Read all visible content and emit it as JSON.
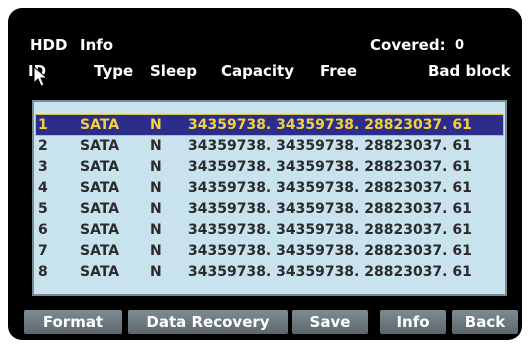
{
  "header": {
    "title_hdd": "HDD",
    "title_info": "Info",
    "covered_label": "Covered:",
    "covered_value": "0"
  },
  "columns": [
    "ID",
    "Type",
    "Sleep",
    "Capacity",
    "Free",
    "Bad block"
  ],
  "rows": [
    {
      "id": "1",
      "type": "SATA",
      "sleep": "N",
      "values": "34359738. 34359738. 28823037. 61"
    },
    {
      "id": "2",
      "type": "SATA",
      "sleep": "N",
      "values": "34359738. 34359738. 28823037. 61"
    },
    {
      "id": "3",
      "type": "SATA",
      "sleep": "N",
      "values": "34359738. 34359738. 28823037. 61"
    },
    {
      "id": "4",
      "type": "SATA",
      "sleep": "N",
      "values": "34359738. 34359738. 28823037. 61"
    },
    {
      "id": "5",
      "type": "SATA",
      "sleep": "N",
      "values": "34359738. 34359738. 28823037. 61"
    },
    {
      "id": "6",
      "type": "SATA",
      "sleep": "N",
      "values": "34359738. 34359738. 28823037. 61"
    },
    {
      "id": "7",
      "type": "SATA",
      "sleep": "N",
      "values": "34359738. 34359738. 28823037. 61"
    },
    {
      "id": "8",
      "type": "SATA",
      "sleep": "N",
      "values": "34359738. 34359738. 28823037. 61"
    }
  ],
  "selected_row": "1",
  "buttons": {
    "format": "Format",
    "data_recovery": "Data Recovery",
    "save": "Save",
    "info": "Info",
    "back": "Back"
  },
  "colors": {
    "panel_bg": "#000000",
    "list_bg": "#c9e3ee",
    "selected_bg": "#2c2d8a",
    "selected_text": "#f2d23a",
    "button_bg": "#6e7a80"
  }
}
